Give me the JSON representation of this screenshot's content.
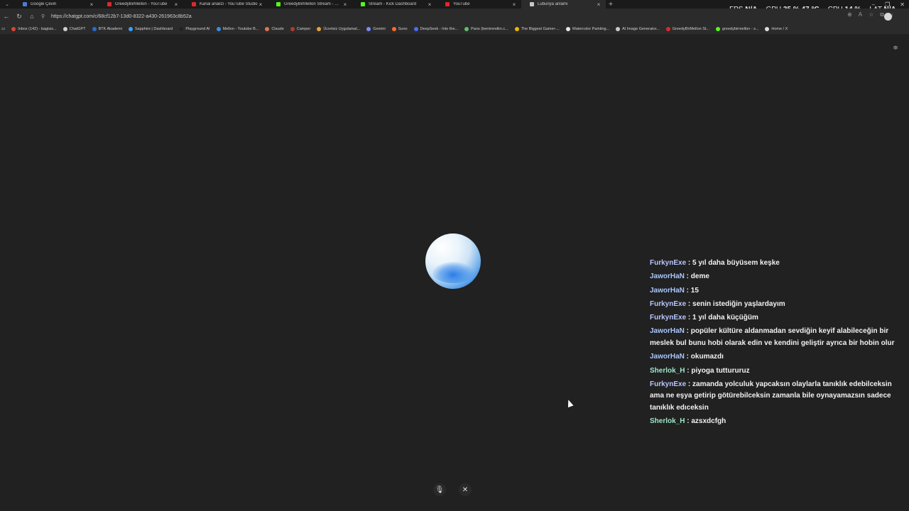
{
  "tabs": [
    {
      "label": "Google Çeviri",
      "color": "#4a7dd6",
      "active": false
    },
    {
      "label": "GreedyBirMellon - YouTube",
      "color": "#e0282a",
      "active": false
    },
    {
      "label": "Kanal analizi - YouTube Studio",
      "color": "#e0282a",
      "active": false
    },
    {
      "label": "GreedyBirMellon Stream - Watch...",
      "color": "#53fc18",
      "active": false
    },
    {
      "label": "Stream - Kick Dashboard",
      "color": "#53fc18",
      "active": false
    },
    {
      "label": "YouTube",
      "color": "#e0282a",
      "active": false
    },
    {
      "label": "Lubunya anlamı",
      "color": "#c7c7c7",
      "active": true
    }
  ],
  "hud": {
    "fps_label": "FPS",
    "fps_value": "N/A",
    "gpu_label": "GPU",
    "gpu_value": "35 % 47 °C",
    "cpu_label": "CPU",
    "cpu_value": "14 %",
    "lat_label": "LAT",
    "lat_value": "N/A"
  },
  "address": {
    "url": "https://chatgpt.com/c/68cf12b7-13d0-8322-a430-261963c8b52a"
  },
  "bookmarks": [
    {
      "label": "Inbox (142) - bagisis...",
      "color": "#d44638"
    },
    {
      "label": "ChatGPT",
      "color": "#cfcfcf"
    },
    {
      "label": "BTK Akademi",
      "color": "#2a6bd1"
    },
    {
      "label": "Sapphire | Dashboard",
      "color": "#3aa0ff"
    },
    {
      "label": "Playground AI",
      "color": "#222222"
    },
    {
      "label": "Mellon - Youtube B...",
      "color": "#3a8fe0"
    },
    {
      "label": "Claude",
      "color": "#d97757"
    },
    {
      "label": "Camper",
      "color": "#b03a2e"
    },
    {
      "label": "Ücretsiz Uygulamal...",
      "color": "#e8a23a"
    },
    {
      "label": "Gemini",
      "color": "#7b8cff"
    },
    {
      "label": "Suno",
      "color": "#ff6a2b"
    },
    {
      "label": "DeepSeek - Into the...",
      "color": "#4d6bfe"
    },
    {
      "label": "Pano (bentrendim.c...",
      "color": "#5fbf6a"
    },
    {
      "label": "The Biggest Gamer-...",
      "color": "#f0b400"
    },
    {
      "label": "Watercolor Painting...",
      "color": "#e8e8e8"
    },
    {
      "label": "AI Image Generator...",
      "color": "#cccccc"
    },
    {
      "label": "GreedyBirMellon St...",
      "color": "#e0282a"
    },
    {
      "label": "greedybirmellon - s...",
      "color": "#53fc18"
    },
    {
      "label": "Home / X",
      "color": "#dddddd"
    }
  ],
  "chat": {
    "messages": [
      {
        "user": "FurkynExe",
        "text": " : 5 yıl daha büyüsem keşke",
        "cls": "u-furky"
      },
      {
        "user": "JaworHaN",
        "text": " : deme",
        "cls": "u-jawor"
      },
      {
        "user": "JaworHaN",
        "text": " : 15",
        "cls": "u-jawor"
      },
      {
        "user": "FurkynExe",
        "text": " : senin istediğin yaşlardayım",
        "cls": "u-furky"
      },
      {
        "user": "FurkynExe",
        "text": " : 1 yıl daha küçüğüm",
        "cls": "u-furky"
      },
      {
        "user": "JaworHaN",
        "text": " : popüler kültüre aldanmadan sevdiğin keyif alabileceğin bir meslek bul bunu hobi olarak edin ve kendini geliştir ayrıca bir hobin olur",
        "cls": "u-jawor"
      },
      {
        "user": "JaworHaN",
        "text": " : okumazdı",
        "cls": "u-jawor"
      },
      {
        "user": "Sherlok_H",
        "text": " : piyoga tuttururuz",
        "cls": "u-sherl"
      },
      {
        "user": "FurkynExe",
        "text": " : zamanda yolculuk yapcaksın olaylarla tanıklık edebilceksin ama ne eşya getirip götürebilceksin zamanla bile oynayamazsın sadece tanıklık edıceksin",
        "cls": "u-furky"
      },
      {
        "user": "Sherlok_H",
        "text": " : azsxdcfgh",
        "cls": "u-sherl"
      }
    ]
  }
}
